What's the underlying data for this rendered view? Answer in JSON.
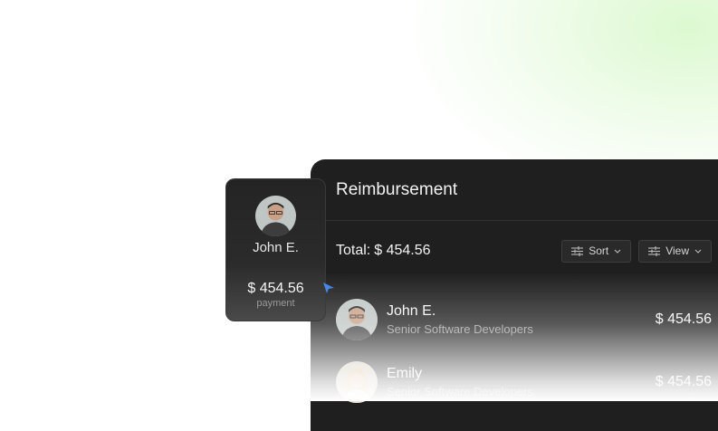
{
  "card": {
    "name": "John E.",
    "amount": "$ 454.56",
    "label": "payment"
  },
  "panel": {
    "title": "Reimbursement",
    "total_label": "Total:",
    "total_value": "$ 454.56",
    "sort_label": "Sort",
    "view_label": "View",
    "rows": [
      {
        "name": "John E.",
        "role": "Senior Software Developers",
        "amount": "$ 454.56"
      },
      {
        "name": "Emily",
        "role": "Senior Software Developers",
        "amount": "$ 454.56"
      }
    ]
  },
  "icons": [
    "sliders-icon",
    "chevron-down-icon",
    "pointer-cursor-icon"
  ],
  "colors": {
    "panel_bg": "#1f1f1f",
    "cursor": "#4a86e8",
    "glow": "#d6f8c8"
  }
}
